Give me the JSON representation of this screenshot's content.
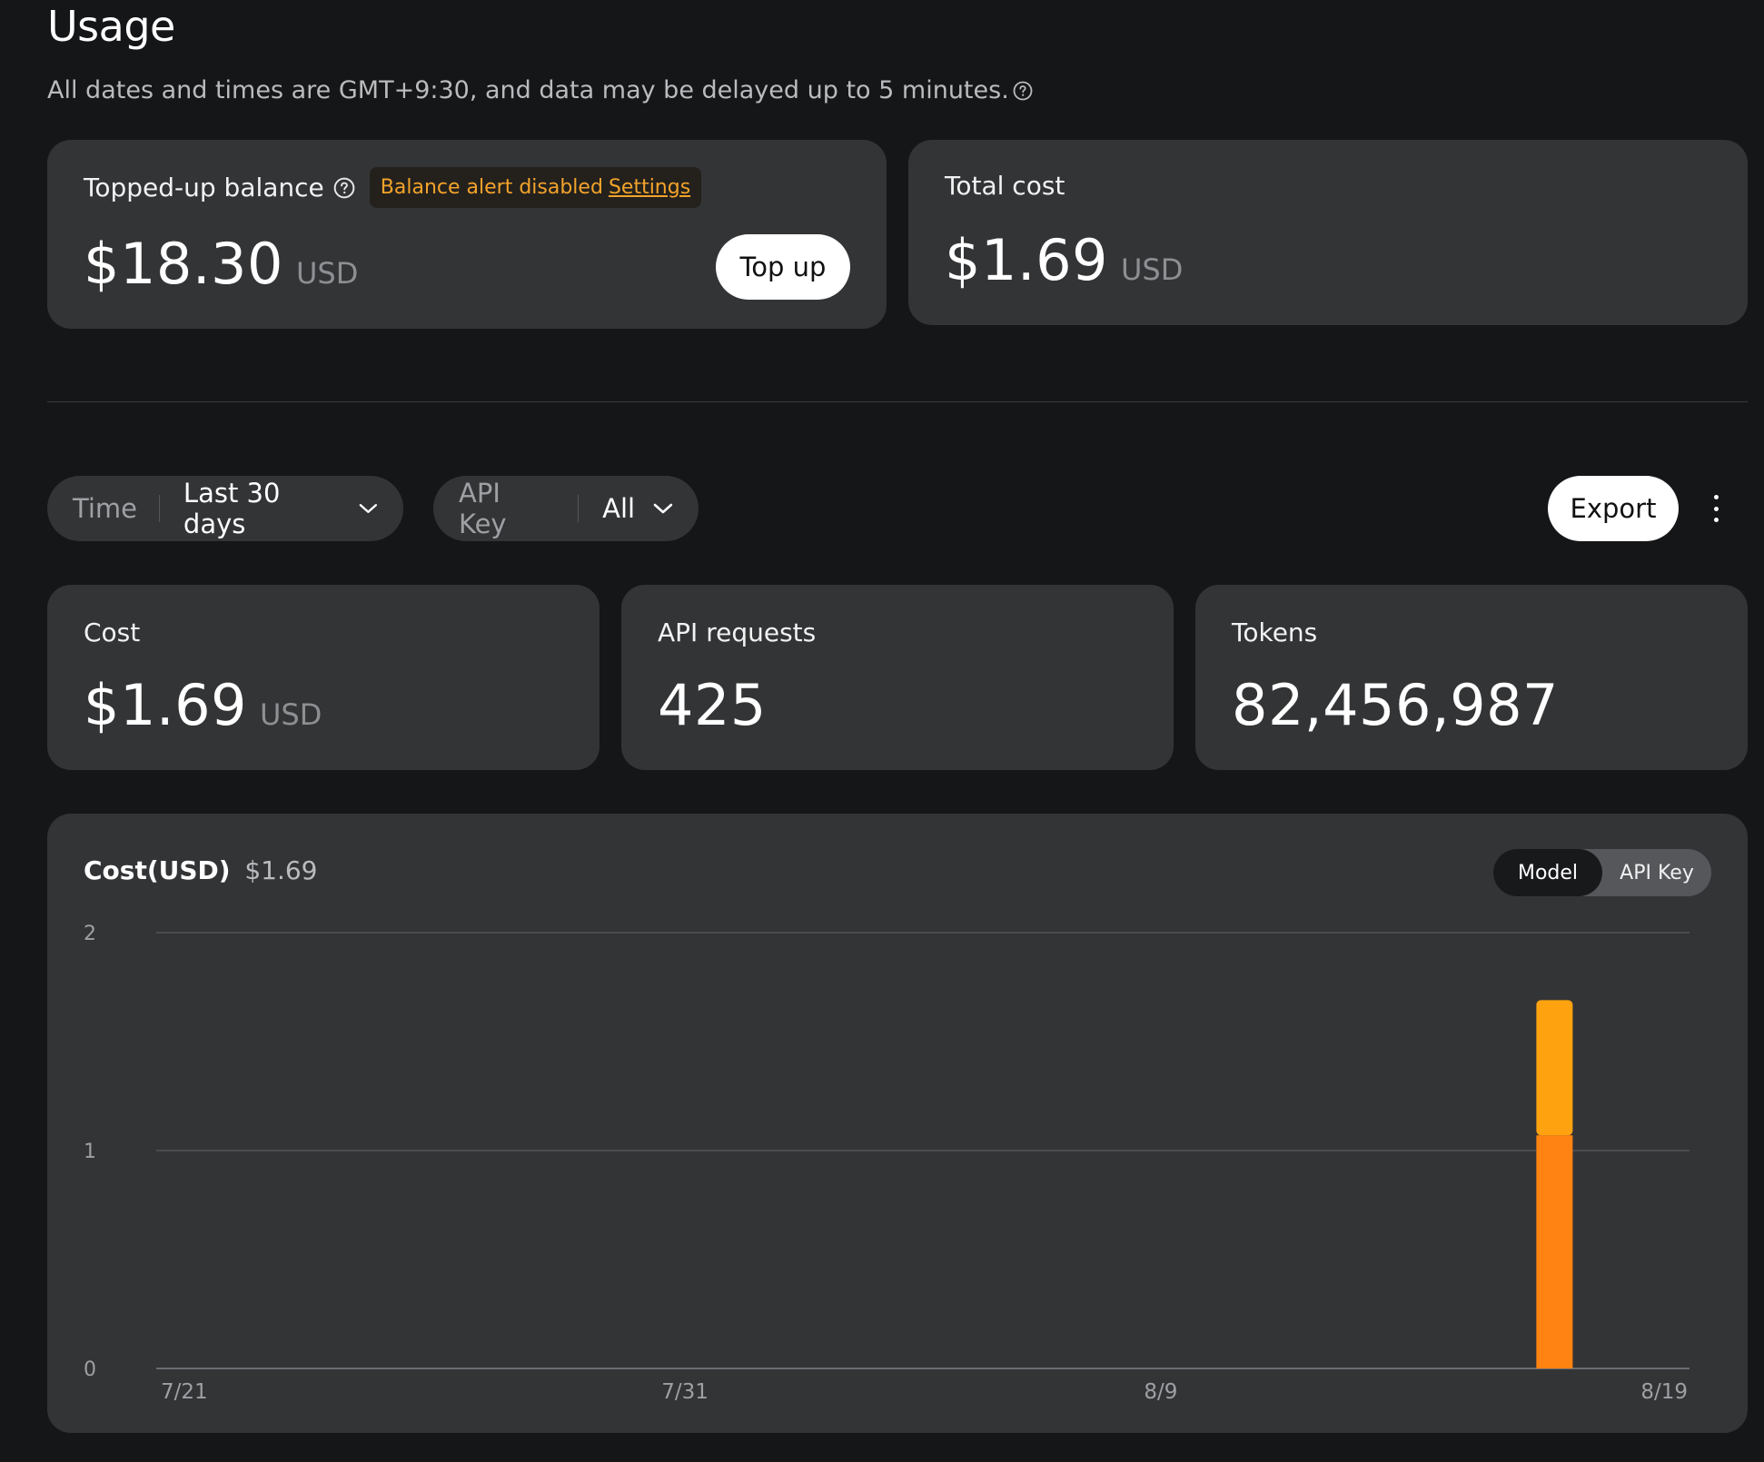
{
  "page": {
    "title": "Usage",
    "subtitle": "All dates and times are GMT+9:30, and data may be delayed up to 5 minutes."
  },
  "balance_card": {
    "label": "Topped-up balance",
    "alert_text": "Balance alert disabled",
    "alert_link": "Settings",
    "amount": "$18.30",
    "unit": "USD",
    "top_up_label": "Top up"
  },
  "total_cost_card": {
    "label": "Total cost",
    "amount": "$1.69",
    "unit": "USD"
  },
  "filters": {
    "time": {
      "label": "Time",
      "value": "Last 30 days"
    },
    "api_key": {
      "label": "API Key",
      "value": "All"
    }
  },
  "toolbar": {
    "export_label": "Export"
  },
  "stats": {
    "cost": {
      "label": "Cost",
      "value": "$1.69",
      "unit": "USD"
    },
    "requests": {
      "label": "API requests",
      "value": "425"
    },
    "tokens": {
      "label": "Tokens",
      "value": "82,456,987"
    }
  },
  "chart_panel": {
    "title": "Cost(USD)",
    "total": "$1.69",
    "toggle": {
      "model": "Model",
      "api_key": "API Key",
      "selected": "Model"
    }
  },
  "colors": {
    "accent_warning": "#f3a32b",
    "series_a": "#ff8312",
    "series_b": "#ffa20f"
  },
  "chart_data": {
    "type": "bar",
    "stacked": true,
    "x_range": [
      "7/21",
      "8/19"
    ],
    "x_ticks": [
      "7/21",
      "7/31",
      "8/9",
      "8/19"
    ],
    "y_ticks": [
      0,
      1,
      2
    ],
    "ylim": [
      0,
      2
    ],
    "categories": [
      "8/16"
    ],
    "series": [
      {
        "values": [
          1.07
        ],
        "color": "#ff8312"
      },
      {
        "values": [
          0.62
        ],
        "color": "#ffa20f"
      }
    ],
    "grid": true
  }
}
